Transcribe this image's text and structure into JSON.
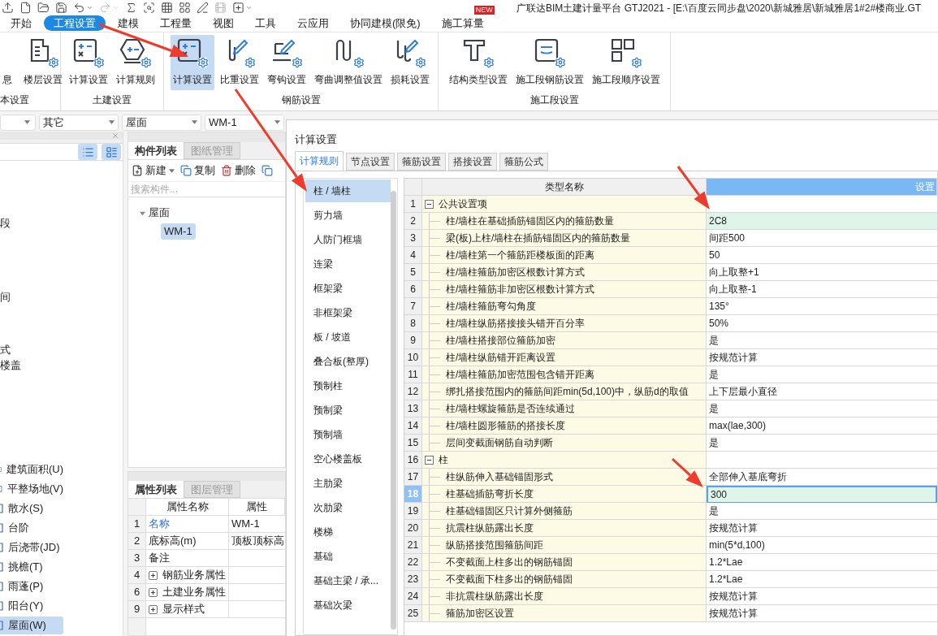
{
  "window": {
    "title": "广联达BIM土建计量平台 GTJ2021 - [E:\\百度云同步盘\\2020\\新城雅居\\新城雅居1#2#楼商业.GT"
  },
  "menu_tabs": [
    {
      "label": "开始",
      "selected": false
    },
    {
      "label": "工程设置",
      "selected": true
    },
    {
      "label": "建模",
      "selected": false
    },
    {
      "label": "工程量",
      "selected": false
    },
    {
      "label": "视图",
      "selected": false
    },
    {
      "label": "工具",
      "selected": false
    },
    {
      "label": "云应用",
      "selected": false
    },
    {
      "label": "协同建模(限免)",
      "selected": false
    },
    {
      "label": "施工算量",
      "selected": false,
      "badge": "NEW"
    }
  ],
  "ribbon_groups": [
    {
      "label": "本设置",
      "buttons": [
        {
          "label": "息",
          "selected": false
        },
        {
          "label": "楼层设置",
          "selected": false
        }
      ]
    },
    {
      "label": "土建设置",
      "buttons": [
        {
          "label": "计算设置",
          "selected": false
        },
        {
          "label": "计算规则",
          "selected": false
        }
      ]
    },
    {
      "label": "钢筋设置",
      "buttons": [
        {
          "label": "计算设置",
          "selected": true
        },
        {
          "label": "比重设置",
          "selected": false
        },
        {
          "label": "弯钩设置",
          "selected": false
        },
        {
          "label": "弯曲调整值设置",
          "selected": false
        },
        {
          "label": "损耗设置",
          "selected": false
        }
      ]
    },
    {
      "label": "施工段设置",
      "buttons": [
        {
          "label": "结构类型设置",
          "selected": false
        },
        {
          "label": "施工段钢筋设置",
          "selected": false
        },
        {
          "label": "施工段顺序设置",
          "selected": false
        }
      ]
    }
  ],
  "filter_bar": {
    "dropdowns": [
      "其它",
      "屋面",
      "WM-1"
    ]
  },
  "navigator": {
    "partial_items": [
      "段",
      "间",
      "式",
      "楼盖"
    ],
    "items": [
      {
        "label": "建筑面积(U)",
        "selected": false
      },
      {
        "label": "平整场地(V)",
        "selected": false
      },
      {
        "label": "散水(S)",
        "selected": false
      },
      {
        "label": "台阶",
        "selected": false
      },
      {
        "label": "后浇带(JD)",
        "selected": false
      },
      {
        "label": "挑檐(T)",
        "selected": false
      },
      {
        "label": "雨蓬(P)",
        "selected": false
      },
      {
        "label": "阳台(Y)",
        "selected": false
      },
      {
        "label": "屋面(W)",
        "selected": true
      }
    ]
  },
  "component_panel": {
    "tabs": [
      {
        "label": "构件列表",
        "selected": true
      },
      {
        "label": "图纸管理",
        "selected": false
      }
    ],
    "toolbar": [
      "新建",
      "复制",
      "删除"
    ],
    "search": {
      "placeholder": "搜索构件..."
    },
    "tree": [
      {
        "label": "屋面",
        "expanded": true,
        "children": [
          {
            "label": "WM-1",
            "selected": true
          }
        ]
      }
    ]
  },
  "property_panel": {
    "tabs": [
      {
        "label": "属性列表",
        "selected": true
      },
      {
        "label": "图层管理",
        "selected": false
      }
    ],
    "columns": [
      "属性名称",
      "属性"
    ],
    "rows": [
      {
        "num": "1",
        "kind": "title",
        "name": "名称",
        "value": "WM-1"
      },
      {
        "num": "2",
        "kind": "plain",
        "name": "底标高(m)",
        "value": "顶板顶标高"
      },
      {
        "num": "3",
        "kind": "plain",
        "name": "备注"
      },
      {
        "num": "4",
        "kind": "group",
        "expanded": false,
        "name": "钢筋业务属性"
      },
      {
        "num": "6",
        "kind": "group",
        "expanded": false,
        "name": "土建业务属性"
      },
      {
        "num": "9",
        "kind": "group",
        "expanded": false,
        "name": "显示样式"
      }
    ]
  },
  "settings_dialog": {
    "title": "计算设置",
    "tabs": [
      {
        "label": "计算规则",
        "selected": true
      },
      {
        "label": "节点设置",
        "selected": false
      },
      {
        "label": "箍筋设置",
        "selected": false
      },
      {
        "label": "搭接设置",
        "selected": false
      },
      {
        "label": "箍筋公式",
        "selected": false
      }
    ],
    "categories": [
      {
        "label": "柱 / 墙柱",
        "selected": true
      },
      {
        "label": "剪力墙",
        "selected": false
      },
      {
        "label": "人防门框墙",
        "selected": false
      },
      {
        "label": "连梁",
        "selected": false
      },
      {
        "label": "框架梁",
        "selected": false
      },
      {
        "label": "非框架梁",
        "selected": false
      },
      {
        "label": "板 / 坡道",
        "selected": false
      },
      {
        "label": "叠合板(整厚)",
        "selected": false
      },
      {
        "label": "预制柱",
        "selected": false
      },
      {
        "label": "预制梁",
        "selected": false
      },
      {
        "label": "预制墙",
        "selected": false
      },
      {
        "label": "空心楼盖板",
        "selected": false
      },
      {
        "label": "主肋梁",
        "selected": false
      },
      {
        "label": "次肋梁",
        "selected": false
      },
      {
        "label": "楼梯",
        "selected": false
      },
      {
        "label": "基础",
        "selected": false
      },
      {
        "label": "基础主梁 / 承...",
        "selected": false
      },
      {
        "label": "基础次梁",
        "selected": false
      }
    ],
    "columns": [
      "类型名称",
      "设置"
    ],
    "rows": [
      {
        "num": "1",
        "kind": "group",
        "expanded": true,
        "name": "公共设置项",
        "highlighted": false,
        "selected": false
      },
      {
        "num": "2",
        "kind": "item",
        "name": "柱/墙柱在基础插筋锚固区内的箍筋数量",
        "value": "2C8",
        "highlighted": true,
        "selected": false
      },
      {
        "num": "3",
        "kind": "item",
        "name": "梁(板)上柱/墙柱在插筋锚固区内的箍筋数量",
        "value": "间距500",
        "highlighted": false,
        "selected": false
      },
      {
        "num": "4",
        "kind": "item",
        "name": "柱/墙柱第一个箍筋距楼板面的距离",
        "value": "50",
        "highlighted": false,
        "selected": false
      },
      {
        "num": "5",
        "kind": "item",
        "name": "柱/墙柱箍筋加密区根数计算方式",
        "value": "向上取整+1",
        "highlighted": false,
        "selected": false
      },
      {
        "num": "6",
        "kind": "item",
        "name": "柱/墙柱箍筋非加密区根数计算方式",
        "value": "向上取整-1",
        "highlighted": false,
        "selected": false
      },
      {
        "num": "7",
        "kind": "item",
        "name": "柱/墙柱箍筋弯勾角度",
        "value": "135°",
        "highlighted": false,
        "selected": false
      },
      {
        "num": "8",
        "kind": "item",
        "name": "柱/墙柱纵筋搭接接头错开百分率",
        "value": "50%",
        "highlighted": false,
        "selected": false
      },
      {
        "num": "9",
        "kind": "item",
        "name": "柱/墙柱搭接部位箍筋加密",
        "value": "是",
        "highlighted": false,
        "selected": false
      },
      {
        "num": "10",
        "kind": "item",
        "name": "柱/墙柱纵筋错开距离设置",
        "value": "按规范计算",
        "highlighted": false,
        "selected": false
      },
      {
        "num": "11",
        "kind": "item",
        "name": "柱/墙柱箍筋加密范围包含错开距离",
        "value": "是",
        "highlighted": false,
        "selected": false
      },
      {
        "num": "12",
        "kind": "item",
        "name": "绑扎搭接范围内的箍筋间距min(5d,100)中，纵筋d的取值",
        "value": "上下层最小直径",
        "highlighted": false,
        "selected": false
      },
      {
        "num": "13",
        "kind": "item",
        "name": "柱/墙柱螺旋箍筋是否连续通过",
        "value": "是",
        "highlighted": false,
        "selected": false
      },
      {
        "num": "14",
        "kind": "item",
        "name": "柱/墙柱圆形箍筋的搭接长度",
        "value": "max(lae,300)",
        "highlighted": false,
        "selected": false
      },
      {
        "num": "15",
        "kind": "item",
        "name": "层间变截面钢筋自动判断",
        "value": "是",
        "highlighted": false,
        "selected": false
      },
      {
        "num": "16",
        "kind": "group",
        "expanded": true,
        "name": "柱",
        "highlighted": false,
        "selected": false
      },
      {
        "num": "17",
        "kind": "item",
        "name": "柱纵筋伸入基础锚固形式",
        "value": "全部伸入基底弯折",
        "highlighted": false,
        "selected": false
      },
      {
        "num": "18",
        "kind": "item",
        "name": "柱基础插筋弯折长度",
        "value": "300",
        "highlighted": true,
        "selected": true
      },
      {
        "num": "19",
        "kind": "item",
        "name": "柱基础锚固区只计算外侧箍筋",
        "value": "是",
        "highlighted": false,
        "selected": false
      },
      {
        "num": "20",
        "kind": "item",
        "name": "抗震柱纵筋露出长度",
        "value": "按规范计算",
        "highlighted": false,
        "selected": false
      },
      {
        "num": "21",
        "kind": "item",
        "name": "纵筋搭接范围箍筋间距",
        "value": "min(5*d,100)",
        "highlighted": false,
        "selected": false
      },
      {
        "num": "22",
        "kind": "item",
        "name": "不变截面上柱多出的钢筋锚固",
        "value": "1.2*Lae",
        "highlighted": false,
        "selected": false
      },
      {
        "num": "23",
        "kind": "item",
        "name": "不变截面下柱多出的钢筋锚固",
        "value": "1.2*Lae",
        "highlighted": false,
        "selected": false
      },
      {
        "num": "24",
        "kind": "item",
        "name": "非抗震柱纵筋露出长度",
        "value": "按规范计算",
        "highlighted": false,
        "selected": false
      },
      {
        "num": "25",
        "kind": "item",
        "name": "箍筋加密区设置",
        "value": "按规范计算",
        "highlighted": false,
        "selected": false
      }
    ]
  }
}
